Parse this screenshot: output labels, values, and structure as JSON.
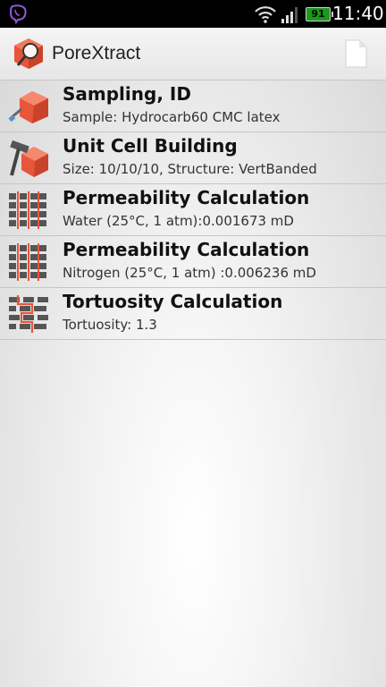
{
  "status_bar": {
    "left_icon": "viber-icon",
    "wifi_icon": "wifi-icon",
    "signal_icon": "signal-icon",
    "battery_level": "91",
    "time": "11:40"
  },
  "action_bar": {
    "app_icon": "porextract-logo-icon",
    "title": "PoreXtract",
    "action_icon": "document-icon"
  },
  "items": [
    {
      "icon": "sampling-cube-icon",
      "title": "Sampling, ID",
      "subtitle": "Sample: Hydrocarb60 CMC latex"
    },
    {
      "icon": "hammer-cube-icon",
      "title": "Unit Cell Building",
      "subtitle": "Size: 10/10/10, Structure: VertBanded"
    },
    {
      "icon": "permeability-grid-icon",
      "title": "Permeability Calculation",
      "subtitle": "Water (25°C, 1 atm):0.001673 mD"
    },
    {
      "icon": "permeability-grid-icon",
      "title": "Permeability Calculation",
      "subtitle": "Nitrogen (25°C, 1 atm) :0.006236 mD"
    },
    {
      "icon": "tortuosity-path-icon",
      "title": "Tortuosity Calculation",
      "subtitle": "Tortuosity: 1.3"
    }
  ],
  "colors": {
    "accent_orange": "#e8553a",
    "status_bar": "#000000",
    "battery_green": "#1a9a1a"
  }
}
